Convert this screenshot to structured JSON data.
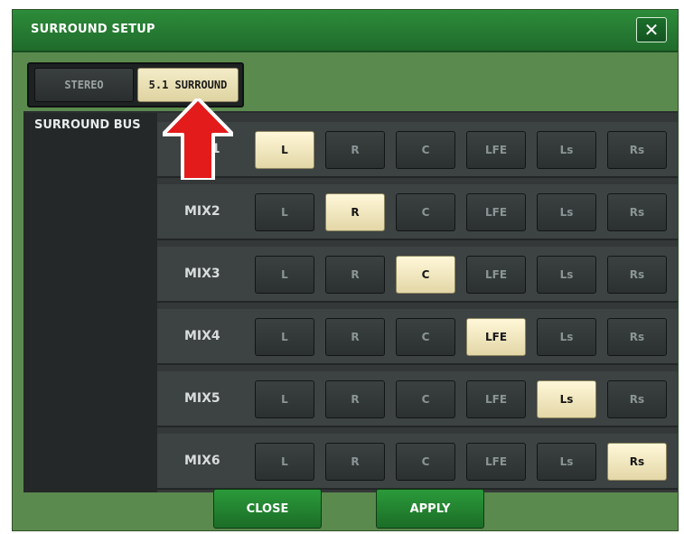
{
  "window": {
    "title": "SURROUND SETUP",
    "close_symbol": "✕"
  },
  "mode": {
    "options": [
      "STEREO",
      "5.1 SURROUND"
    ],
    "selected": "5.1 SURROUND"
  },
  "surround_bus": {
    "label": "SURROUND BUS",
    "channels": [
      "L",
      "R",
      "C",
      "LFE",
      "Ls",
      "Rs"
    ],
    "rows": [
      {
        "label": "MIX1",
        "active": "L"
      },
      {
        "label": "MIX2",
        "active": "R"
      },
      {
        "label": "MIX3",
        "active": "C"
      },
      {
        "label": "MIX4",
        "active": "LFE"
      },
      {
        "label": "MIX5",
        "active": "Ls"
      },
      {
        "label": "MIX6",
        "active": "Rs"
      }
    ]
  },
  "footer": {
    "close_label": "CLOSE",
    "apply_label": "APPLY"
  },
  "colors": {
    "panel_bg": "#5b8a4e",
    "title_bg": "#1f6b2b",
    "active_channel": "#fff7d8",
    "arrow": "#e31b1b"
  },
  "icons": {
    "close": "close-icon",
    "pointer": "arrow-up-icon"
  }
}
